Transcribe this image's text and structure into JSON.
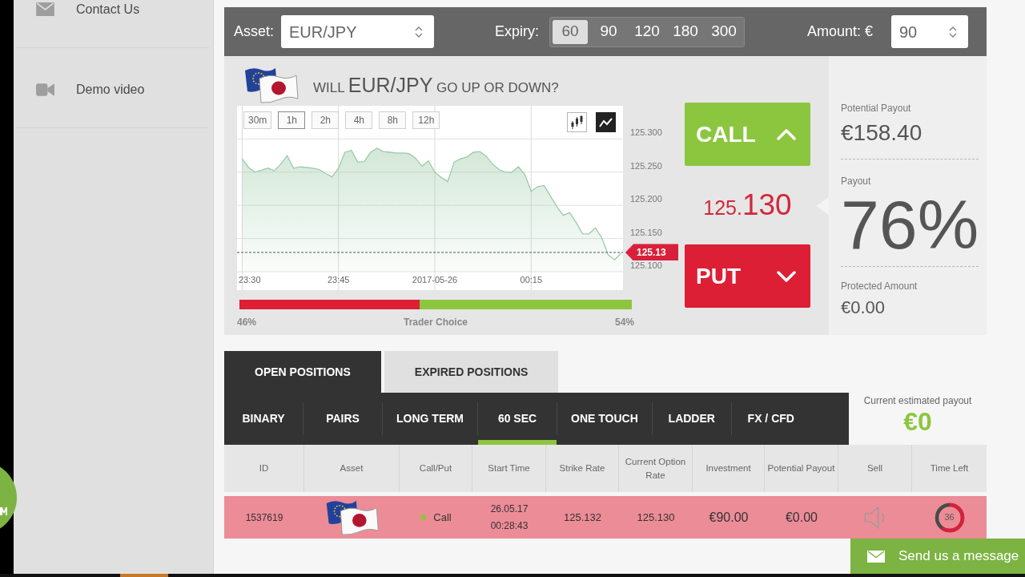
{
  "sidebar": {
    "items": [
      {
        "kind": "mail",
        "label": "Contact Us"
      },
      {
        "kind": "video",
        "label": "Demo video"
      }
    ]
  },
  "trade_bar": {
    "asset_label": "Asset:",
    "asset_value": "EUR/JPY",
    "expiry_label": "Expiry:",
    "expiry_options": [
      {
        "label": "60",
        "selected": true
      },
      {
        "label": "90",
        "selected": false
      },
      {
        "label": "120",
        "selected": false
      },
      {
        "label": "180",
        "selected": false
      },
      {
        "label": "300",
        "selected": false
      }
    ],
    "amount_label": "Amount: €",
    "amount_value": "90"
  },
  "question": {
    "lead": "WILL",
    "asset": "EUR/JPY",
    "tail": "GO UP OR DOWN?"
  },
  "chart": {
    "timeframes": [
      {
        "label": "30m",
        "selected": false
      },
      {
        "label": "1h",
        "selected": true
      },
      {
        "label": "2h",
        "selected": false
      },
      {
        "label": "4h",
        "selected": false
      },
      {
        "label": "8h",
        "selected": false
      },
      {
        "label": "12h",
        "selected": false
      }
    ],
    "chart_types": [
      {
        "kind": "candlestick",
        "selected": false
      },
      {
        "kind": "line",
        "selected": true
      }
    ],
    "chart_data": {
      "type": "area",
      "grid": true,
      "categories": [
        "23:30",
        null,
        null,
        null,
        null,
        null,
        null,
        null,
        null,
        null,
        null,
        null,
        null,
        null,
        null,
        "23:45",
        null,
        null,
        null,
        null,
        null,
        null,
        null,
        null,
        null,
        null,
        null,
        null,
        null,
        null,
        "2017-05-26",
        null,
        null,
        null,
        null,
        null,
        null,
        null,
        null,
        null,
        null,
        null,
        null,
        null,
        null,
        "00:15",
        null,
        null,
        null,
        null,
        null,
        null,
        null,
        null,
        null,
        null,
        null,
        null,
        null,
        null
      ],
      "series": [
        {
          "color": "#9ccba8",
          "values": [
            125.27,
            125.257,
            125.25,
            125.253,
            125.256,
            125.252,
            125.262,
            125.275,
            125.256,
            125.258,
            125.257,
            125.256,
            125.254,
            125.248,
            125.243,
            125.256,
            125.28,
            125.283,
            125.265,
            125.266,
            125.28,
            125.286,
            125.281,
            125.28,
            125.279,
            125.279,
            125.278,
            125.271,
            125.259,
            125.267,
            125.25,
            125.242,
            125.236,
            125.265,
            125.27,
            125.273,
            125.28,
            125.281,
            125.274,
            125.262,
            125.254,
            125.25,
            125.25,
            125.258,
            125.247,
            125.221,
            125.228,
            125.23,
            125.214,
            125.198,
            125.185,
            125.189,
            125.174,
            125.157,
            125.157,
            125.166,
            125.151,
            125.125,
            125.118,
            125.128
          ]
        }
      ],
      "ylim": [
        125.1,
        125.35
      ],
      "yticks": [
        {
          "value": 125.1,
          "label": "125.100"
        },
        {
          "value": 125.15,
          "label": "125.150"
        },
        {
          "value": 125.2,
          "label": "125.200"
        },
        {
          "value": 125.25,
          "label": "125.250"
        },
        {
          "value": 125.3,
          "label": "125.300"
        }
      ],
      "ref_lines": [
        {
          "axis": "y",
          "value": 125.129,
          "label": "125.13"
        }
      ]
    }
  },
  "trader_choice": {
    "label": "Trader Choice",
    "level": 0.46,
    "left_reading": "46%",
    "right_reading": "54%"
  },
  "call_button": "CALL",
  "rate": {
    "prefix": "125.",
    "pips": "130"
  },
  "put_button": "PUT",
  "payout_panel": {
    "potential_payout_label": "Potential Payout",
    "potential_payout": "€158.40",
    "payout_label": "Payout",
    "payout": "76%",
    "protected_label": "Protected Amount",
    "protected_amount": "€0.00"
  },
  "positions": {
    "tabs": [
      {
        "label": "OPEN POSITIONS",
        "selected": true
      },
      {
        "label": "EXPIRED POSITIONS",
        "selected": false
      }
    ],
    "categories": [
      {
        "label": "BINARY",
        "selected": false
      },
      {
        "label": "PAIRS",
        "selected": false
      },
      {
        "label": "LONG TERM",
        "selected": false
      },
      {
        "label": "60 SEC",
        "selected": true
      },
      {
        "label": "ONE TOUCH",
        "selected": false
      },
      {
        "label": "LADDER",
        "selected": false
      },
      {
        "label": "FX / CFD",
        "selected": false
      }
    ],
    "estimated_payout_label": "Current estimated payout",
    "estimated_payout": "€0",
    "columns": [
      "ID",
      "Asset",
      "Call/Put",
      "Start Time",
      "Strike Rate",
      "Current Option Rate",
      "Investment",
      "Potential Payout",
      "Sell",
      "Time Left"
    ],
    "rows": [
      {
        "id": "1537619",
        "in_the_money": false,
        "direction": {
          "label": "Call",
          "color": "#8cc63f"
        },
        "start_date": "26.05.17",
        "start_time": "00:28:43",
        "strike_rate": "125.132",
        "current_rate": "125.130",
        "investment": "€90.00",
        "potential_payout": "€0.00",
        "time_left": {
          "text": "36",
          "level": 0.6
        }
      }
    ]
  },
  "message_button": "Send us a message"
}
